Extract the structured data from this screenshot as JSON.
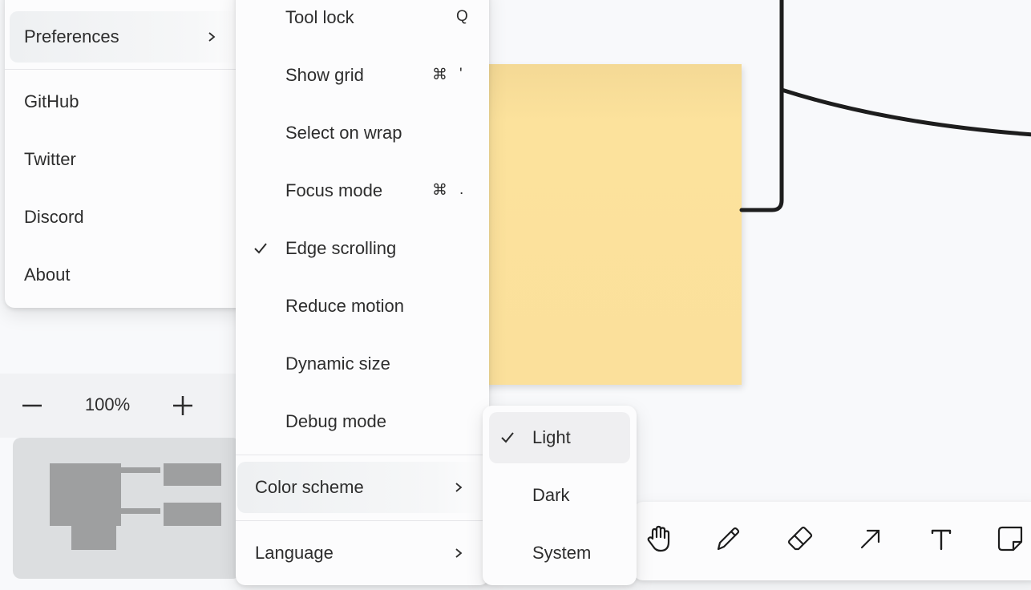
{
  "main_menu": {
    "items": [
      {
        "label": "Preferences"
      },
      {
        "label": "GitHub"
      },
      {
        "label": "Twitter"
      },
      {
        "label": "Discord"
      },
      {
        "label": "About"
      }
    ]
  },
  "preferences_menu": {
    "items": [
      {
        "label": "Tool lock",
        "shortcut_mod": "",
        "shortcut_key": "Q",
        "checked": false
      },
      {
        "label": "Show grid",
        "shortcut_mod": "⌘",
        "shortcut_key": "'",
        "checked": false
      },
      {
        "label": "Select on wrap",
        "shortcut_mod": "",
        "shortcut_key": "",
        "checked": false
      },
      {
        "label": "Focus mode",
        "shortcut_mod": "⌘",
        "shortcut_key": ".",
        "checked": false
      },
      {
        "label": "Edge scrolling",
        "shortcut_mod": "",
        "shortcut_key": "",
        "checked": true
      },
      {
        "label": "Reduce motion",
        "shortcut_mod": "",
        "shortcut_key": "",
        "checked": false
      },
      {
        "label": "Dynamic size",
        "shortcut_mod": "",
        "shortcut_key": "",
        "checked": false
      },
      {
        "label": "Debug mode",
        "shortcut_mod": "",
        "shortcut_key": "",
        "checked": false
      }
    ],
    "color_scheme_label": "Color scheme",
    "language_label": "Language"
  },
  "color_scheme_menu": {
    "items": [
      {
        "label": "Light",
        "checked": true
      },
      {
        "label": "Dark",
        "checked": false
      },
      {
        "label": "System",
        "checked": false
      }
    ]
  },
  "zoom": {
    "value": "100%",
    "minus_icon": "minus-icon",
    "plus_icon": "plus-icon"
  },
  "toolbar": {
    "tools": [
      "hand-icon",
      "pencil-icon",
      "eraser-icon",
      "arrow-icon",
      "text-icon",
      "note-icon"
    ]
  },
  "colors": {
    "sticky_note": "#fbe09b",
    "accent_text": "#2d2d2d"
  }
}
